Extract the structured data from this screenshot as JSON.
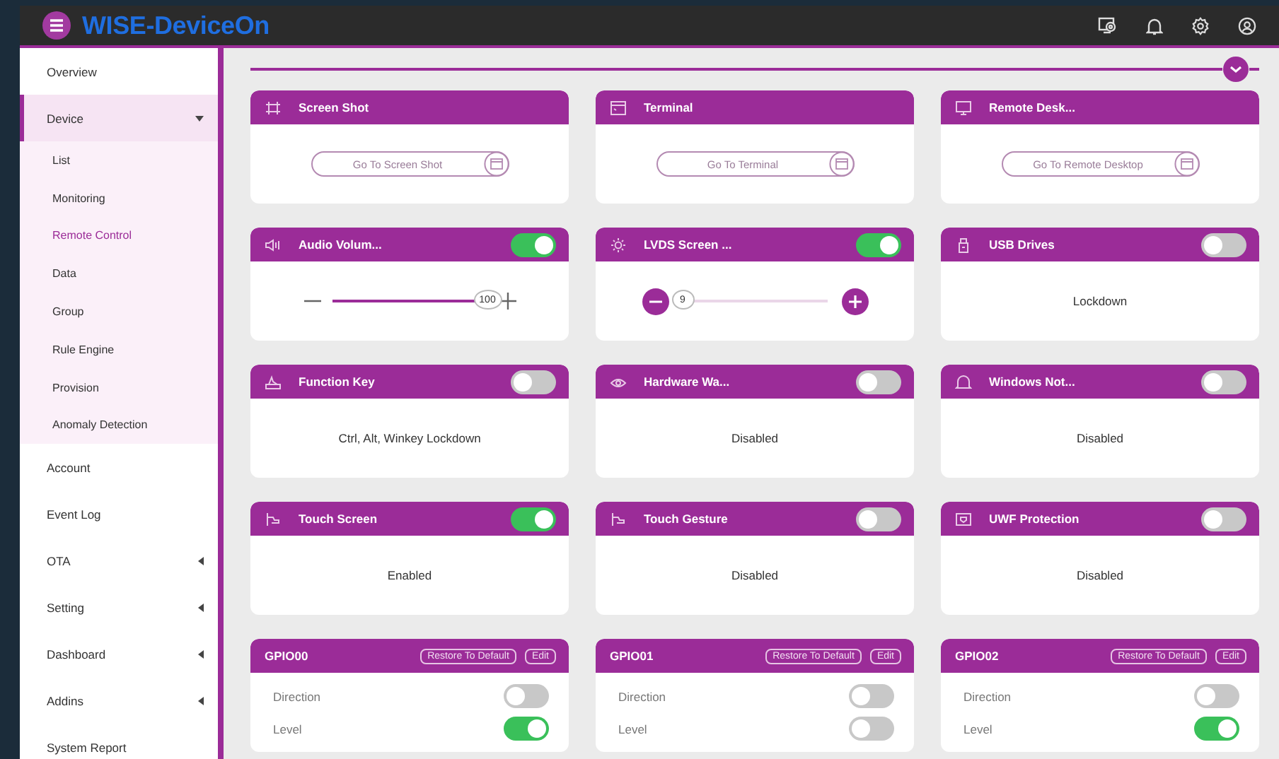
{
  "app": {
    "title": "WISE-DeviceOn"
  },
  "sidebar": {
    "items": [
      {
        "label": "Overview",
        "kind": "link",
        "selected": false
      },
      {
        "label": "Device",
        "kind": "group",
        "expanded": true,
        "selected": true,
        "children": [
          {
            "label": "List",
            "selected": false
          },
          {
            "label": "Monitoring",
            "selected": false
          },
          {
            "label": "Remote Control",
            "selected": true
          },
          {
            "label": "Data",
            "selected": false
          },
          {
            "label": "Group",
            "selected": false
          },
          {
            "label": "Rule Engine",
            "selected": false
          },
          {
            "label": "Provision",
            "selected": false
          },
          {
            "label": "Anomaly Detection",
            "selected": false
          }
        ]
      },
      {
        "label": "Account",
        "kind": "link",
        "selected": false
      },
      {
        "label": "Event Log",
        "kind": "link",
        "selected": false
      },
      {
        "label": "OTA",
        "kind": "group",
        "expanded": false,
        "selected": false
      },
      {
        "label": "Setting",
        "kind": "group",
        "expanded": false,
        "selected": false
      },
      {
        "label": "Dashboard",
        "kind": "group",
        "expanded": false,
        "selected": false
      },
      {
        "label": "Addins",
        "kind": "group",
        "expanded": false,
        "selected": false
      },
      {
        "label": "System Report",
        "kind": "link",
        "selected": false
      }
    ]
  },
  "cards": [
    {
      "kind": "link",
      "title": "Screen Shot",
      "button": "Go To Screen Shot"
    },
    {
      "kind": "link",
      "title": "Terminal",
      "button": "Go To Terminal"
    },
    {
      "kind": "link",
      "title": "Remote Desk...",
      "button": "Go To Remote Desktop"
    },
    {
      "kind": "slider",
      "title": "Audio Volum...",
      "on": true,
      "level": 1.0,
      "reading": "100"
    },
    {
      "kind": "stepper",
      "title": "LVDS Screen ...",
      "on": true,
      "level": 0.0,
      "reading": "9"
    },
    {
      "kind": "status",
      "title": "USB Drives",
      "on": false,
      "status": "Lockdown"
    },
    {
      "kind": "status",
      "title": "Function Key",
      "on": false,
      "status": "Ctrl, Alt, Winkey Lockdown"
    },
    {
      "kind": "status",
      "title": "Hardware Wa...",
      "on": false,
      "status": "Disabled"
    },
    {
      "kind": "status",
      "title": "Windows Not...",
      "on": false,
      "status": "Disabled"
    },
    {
      "kind": "status",
      "title": "Touch Screen",
      "on": true,
      "status": "Enabled"
    },
    {
      "kind": "status",
      "title": "Touch Gesture",
      "on": false,
      "status": "Disabled"
    },
    {
      "kind": "status",
      "title": "UWF Protection",
      "on": false,
      "status": "Disabled"
    },
    {
      "kind": "gpio",
      "title": "GPIO00",
      "restore": "Restore To Default",
      "edit": "Edit",
      "rows": [
        {
          "label": "Direction",
          "on": false
        },
        {
          "label": "Level",
          "on": true
        }
      ]
    },
    {
      "kind": "gpio",
      "title": "GPIO01",
      "restore": "Restore To Default",
      "edit": "Edit",
      "rows": [
        {
          "label": "Direction",
          "on": false
        },
        {
          "label": "Level",
          "on": false
        }
      ]
    },
    {
      "kind": "gpio",
      "title": "GPIO02",
      "restore": "Restore To Default",
      "edit": "Edit",
      "rows": [
        {
          "label": "Direction",
          "on": false
        },
        {
          "label": "Level",
          "on": true
        }
      ]
    }
  ]
}
